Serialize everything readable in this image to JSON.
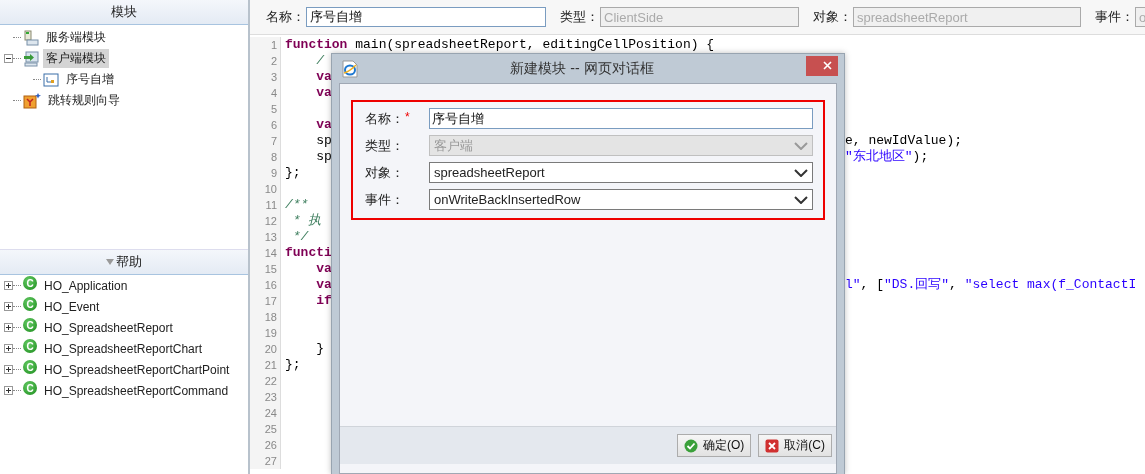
{
  "modules_panel": {
    "title": "模块",
    "tree": [
      {
        "label": "服务端模块",
        "kind": "server",
        "selected": false
      },
      {
        "label": "客户端模块",
        "kind": "client",
        "selected": true,
        "expanded": true,
        "children": [
          {
            "label": "序号自增",
            "kind": "script",
            "selected": false
          }
        ]
      },
      {
        "label": "跳转规则向导",
        "kind": "wizard",
        "selected": false
      }
    ]
  },
  "help_panel": {
    "title": "帮助",
    "items": [
      {
        "label": "HO_Application",
        "badge": "C",
        "expanded": false
      },
      {
        "label": "HO_Event",
        "badge": "C",
        "expanded": false
      },
      {
        "label": "HO_SpreadsheetReport",
        "badge": "C",
        "expanded": false
      },
      {
        "label": "HO_SpreadsheetReportChart",
        "badge": "C",
        "expanded": false
      },
      {
        "label": "HO_SpreadsheetReportChartPoint",
        "badge": "C",
        "expanded": false
      },
      {
        "label": "HO_SpreadsheetReportCommand",
        "badge": "C",
        "expanded": false
      }
    ]
  },
  "properties_bar": {
    "fields": [
      {
        "label": "名称：",
        "value": "序号自增",
        "disabled": false
      },
      {
        "label": "类型：",
        "value": "ClientSide",
        "disabled": true
      },
      {
        "label": "对象：",
        "value": "spreadsheetReport",
        "disabled": true
      },
      {
        "label": "事件：",
        "value": "o",
        "disabled": true
      }
    ]
  },
  "code": {
    "lines": [
      {
        "number": "1",
        "left": [
          {
            "text": "function",
            "kind": "keyword"
          },
          {
            "text": " main(spreadsheetReport, editingCellPosition) {",
            "kind": "plain"
          }
        ]
      },
      {
        "number": "2",
        "left": [
          {
            "text": "    /",
            "kind": "comment"
          }
        ]
      },
      {
        "number": "3",
        "left": [
          {
            "text": "    va",
            "kind": "keyword"
          }
        ]
      },
      {
        "number": "4",
        "left": [
          {
            "text": "    va",
            "kind": "keyword"
          }
        ]
      },
      {
        "number": "5"
      },
      {
        "number": "6",
        "left": [
          {
            "text": "    va",
            "kind": "keyword"
          }
        ]
      },
      {
        "number": "7",
        "left": [
          {
            "text": "    sp",
            "kind": "plain"
          }
        ],
        "right": [
          {
            "text": "e, newIdValue);",
            "kind": "plain"
          }
        ]
      },
      {
        "number": "8",
        "left": [
          {
            "text": "    sp",
            "kind": "plain"
          }
        ],
        "right": [
          {
            "text": "\"东北地区\"",
            "kind": "string"
          },
          {
            "text": ");",
            "kind": "plain"
          }
        ]
      },
      {
        "number": "9",
        "left": [
          {
            "text": "};",
            "kind": "plain"
          }
        ]
      },
      {
        "number": "10"
      },
      {
        "number": "11",
        "left": [
          {
            "text": "/**",
            "kind": "comment"
          }
        ]
      },
      {
        "number": "12",
        "left": [
          {
            "text": " * 执",
            "kind": "comment"
          }
        ]
      },
      {
        "number": "13",
        "left": [
          {
            "text": " */",
            "kind": "comment"
          }
        ]
      },
      {
        "number": "14",
        "left": [
          {
            "text": "functi",
            "kind": "keyword"
          }
        ]
      },
      {
        "number": "15",
        "left": [
          {
            "text": "    va",
            "kind": "keyword"
          }
        ]
      },
      {
        "number": "16",
        "left": [
          {
            "text": "    va",
            "kind": "keyword"
          }
        ],
        "right": [
          {
            "text": "l\"",
            "kind": "string"
          },
          {
            "text": ", [",
            "kind": "plain"
          },
          {
            "text": "\"DS.回写\"",
            "kind": "string"
          },
          {
            "text": ", ",
            "kind": "plain"
          },
          {
            "text": "\"select max(f_ContactI",
            "kind": "string"
          }
        ]
      },
      {
        "number": "17",
        "left": [
          {
            "text": "    if",
            "kind": "keyword"
          }
        ]
      },
      {
        "number": "18"
      },
      {
        "number": "19"
      },
      {
        "number": "20",
        "left": [
          {
            "text": "    }",
            "kind": "plain"
          }
        ]
      },
      {
        "number": "21",
        "left": [
          {
            "text": "};",
            "kind": "plain"
          }
        ]
      },
      {
        "number": "22"
      },
      {
        "number": "23"
      },
      {
        "number": "24"
      },
      {
        "number": "25"
      },
      {
        "number": "26"
      },
      {
        "number": "27"
      }
    ]
  },
  "dialog": {
    "title": "新建模块 -- 网页对话框",
    "fields": [
      {
        "label": "名称：",
        "required_mark": "*",
        "kind": "input",
        "value": "序号自增",
        "disabled": false
      },
      {
        "label": "类型：",
        "kind": "select",
        "value": "客户端",
        "disabled": true
      },
      {
        "label": "对象：",
        "kind": "select",
        "value": "spreadsheetReport",
        "disabled": false
      },
      {
        "label": "事件：",
        "kind": "select",
        "value": "onWriteBackInsertedRow",
        "disabled": false
      }
    ],
    "buttons": [
      {
        "label": "确定(O)",
        "kind": "ok"
      },
      {
        "label": "取消(C)",
        "kind": "cancel"
      }
    ]
  }
}
